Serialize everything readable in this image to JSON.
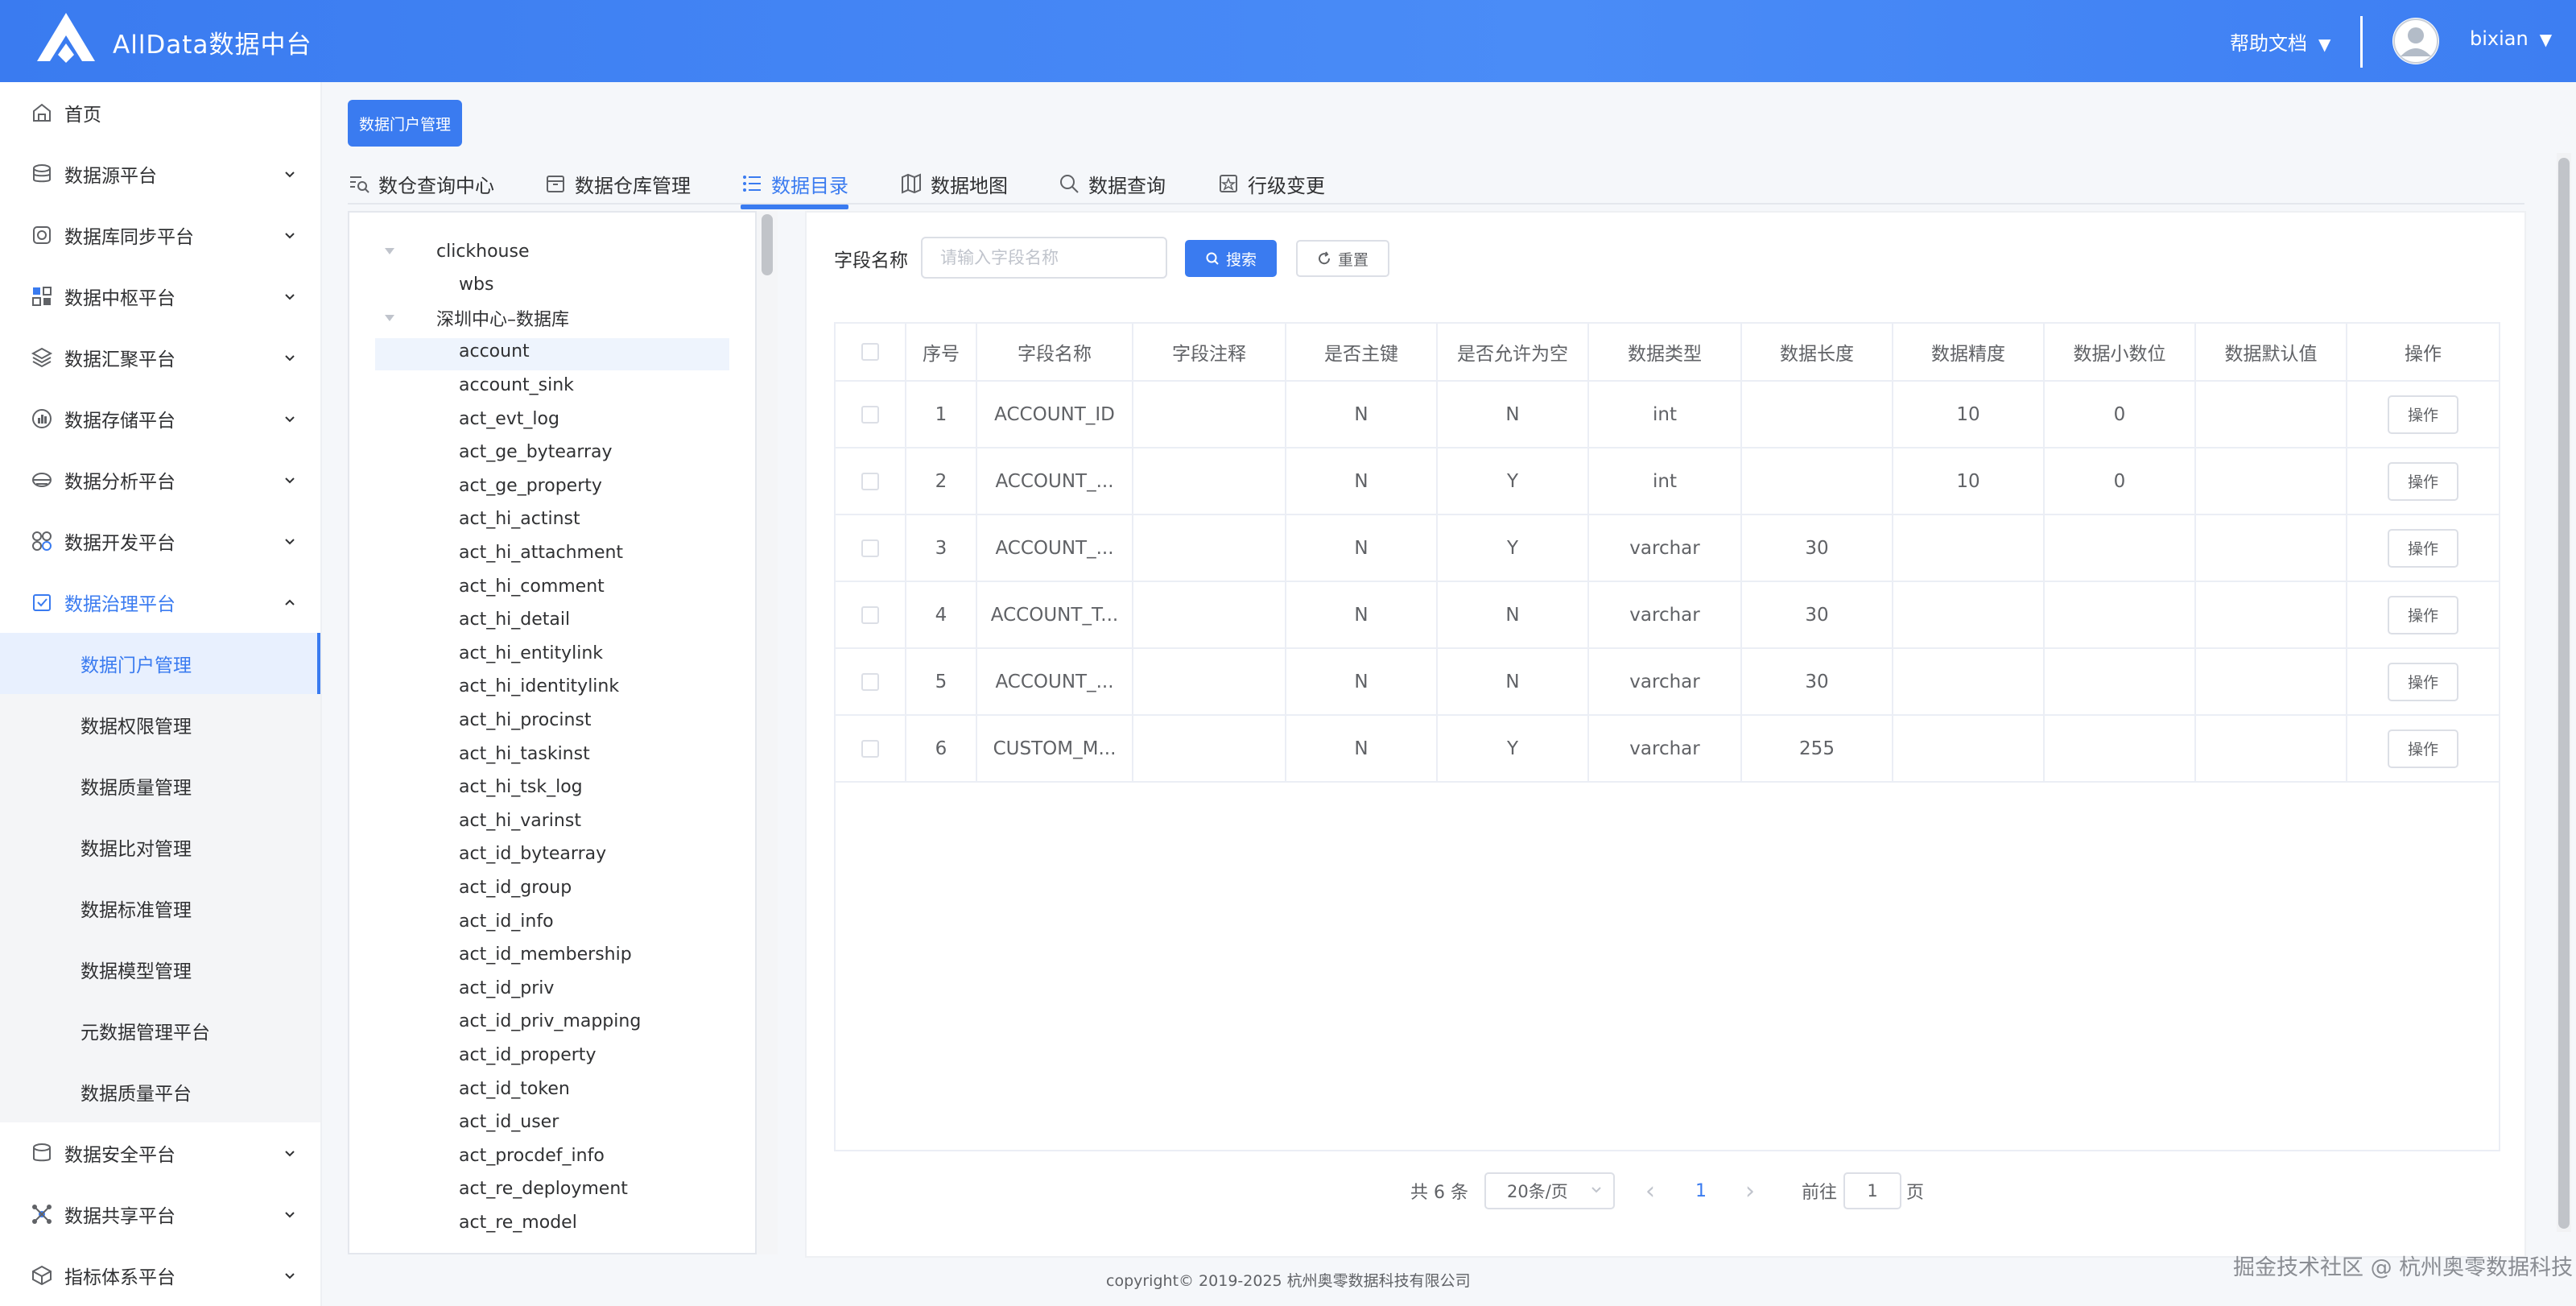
{
  "header": {
    "title": "AllData数据中台",
    "help_label": "帮助文档",
    "user_name": "bixian",
    "arrow": "▼"
  },
  "sidebar": {
    "items": [
      {
        "label": "首页",
        "icon": "home-icon"
      },
      {
        "label": "数据源平台",
        "icon": "database-icon"
      },
      {
        "label": "数据库同步平台",
        "icon": "sync-icon"
      },
      {
        "label": "数据中枢平台",
        "icon": "hub-icon"
      },
      {
        "label": "数据汇聚平台",
        "icon": "layers-icon"
      },
      {
        "label": "数据存储平台",
        "icon": "storage-icon"
      },
      {
        "label": "数据分析平台",
        "icon": "analysis-icon"
      },
      {
        "label": "数据开发平台",
        "icon": "develop-icon"
      },
      {
        "label": "数据治理平台",
        "icon": "governance-icon"
      },
      {
        "label": "数据安全平台",
        "icon": "security-icon"
      },
      {
        "label": "数据共享平台",
        "icon": "share-icon"
      },
      {
        "label": "指标体系平台",
        "icon": "metrics-icon"
      }
    ],
    "sub_items": [
      "数据门户管理",
      "数据权限管理",
      "数据质量管理",
      "数据比对管理",
      "数据标准管理",
      "数据模型管理",
      "元数据管理平台",
      "数据质量平台"
    ]
  },
  "main": {
    "portal_button": "数据门户管理",
    "tabs": [
      {
        "label": "数仓查询中心",
        "icon": "query-center-icon"
      },
      {
        "label": "数据仓库管理",
        "icon": "warehouse-icon"
      },
      {
        "label": "数据目录",
        "icon": "catalog-list-icon"
      },
      {
        "label": "数据地图",
        "icon": "map-icon"
      },
      {
        "label": "数据查询",
        "icon": "search-icon"
      },
      {
        "label": "行级变更",
        "icon": "row-change-icon"
      }
    ],
    "active_tab": "数据目录"
  },
  "tree": {
    "groups": [
      {
        "label": "clickhouse",
        "children": [
          "wbs"
        ]
      },
      {
        "label": "深圳中心–数据库",
        "children": [
          "account",
          "account_sink",
          "act_evt_log",
          "act_ge_bytearray",
          "act_ge_property",
          "act_hi_actinst",
          "act_hi_attachment",
          "act_hi_comment",
          "act_hi_detail",
          "act_hi_entitylink",
          "act_hi_identitylink",
          "act_hi_procinst",
          "act_hi_taskinst",
          "act_hi_tsk_log",
          "act_hi_varinst",
          "act_id_bytearray",
          "act_id_group",
          "act_id_info",
          "act_id_membership",
          "act_id_priv",
          "act_id_priv_mapping",
          "act_id_property",
          "act_id_token",
          "act_id_user",
          "act_procdef_info",
          "act_re_deployment",
          "act_re_model"
        ]
      }
    ],
    "selected": "account"
  },
  "search": {
    "label": "字段名称",
    "placeholder": "请输入字段名称",
    "search_btn": "搜索",
    "reset_btn": "重置"
  },
  "table": {
    "headers": [
      "序号",
      "字段名称",
      "字段注释",
      "是否主键",
      "是否允许为空",
      "数据类型",
      "数据长度",
      "数据精度",
      "数据小数位",
      "数据默认值",
      "操作"
    ],
    "rows": [
      {
        "no": "1",
        "name": "ACCOUNT_ID",
        "comment": "",
        "pk": "N",
        "nullable": "N",
        "type": "int",
        "length": "",
        "precision": "10",
        "scale": "0",
        "default": "",
        "op": "操作"
      },
      {
        "no": "2",
        "name": "ACCOUNT_...",
        "comment": "",
        "pk": "N",
        "nullable": "Y",
        "type": "int",
        "length": "",
        "precision": "10",
        "scale": "0",
        "default": "",
        "op": "操作"
      },
      {
        "no": "3",
        "name": "ACCOUNT_...",
        "comment": "",
        "pk": "N",
        "nullable": "Y",
        "type": "varchar",
        "length": "30",
        "precision": "",
        "scale": "",
        "default": "",
        "op": "操作"
      },
      {
        "no": "4",
        "name": "ACCOUNT_T...",
        "comment": "",
        "pk": "N",
        "nullable": "N",
        "type": "varchar",
        "length": "30",
        "precision": "",
        "scale": "",
        "default": "",
        "op": "操作"
      },
      {
        "no": "5",
        "name": "ACCOUNT_...",
        "comment": "",
        "pk": "N",
        "nullable": "N",
        "type": "varchar",
        "length": "30",
        "precision": "",
        "scale": "",
        "default": "",
        "op": "操作"
      },
      {
        "no": "6",
        "name": "CUSTOM_M...",
        "comment": "",
        "pk": "N",
        "nullable": "Y",
        "type": "varchar",
        "length": "255",
        "precision": "",
        "scale": "",
        "default": "",
        "op": "操作"
      }
    ]
  },
  "pagination": {
    "total": "共 6 条",
    "page_size": "20条/页",
    "current_page": "1",
    "goto_prefix": "前往",
    "goto_value": "1",
    "goto_suffix": "页",
    "prev": "‹",
    "next": "›"
  },
  "footer": {
    "copyright": "copyright© 2019-2025 杭州奥零数据科技有限公司",
    "watermark": "掘金技术社区 @ 杭州奥零数据科技"
  },
  "colors": {
    "accent": "#3a7bf0",
    "header_bg": "#4a8cf7"
  }
}
